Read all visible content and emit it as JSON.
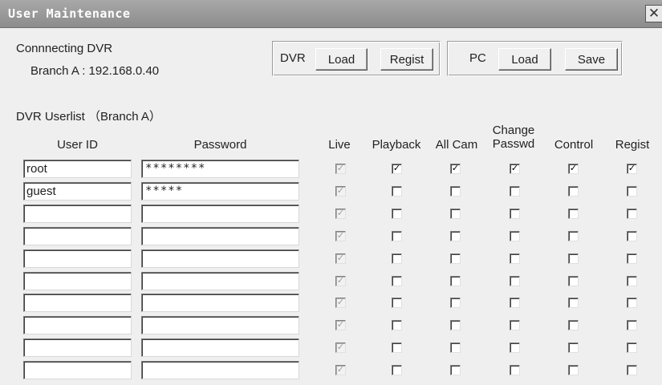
{
  "window": {
    "title": "User Maintenance",
    "close_glyph": "✕"
  },
  "connection": {
    "label": "Connnecting DVR",
    "value": "Branch A : 192.168.0.40"
  },
  "dvr_group": {
    "label": "DVR",
    "load": "Load",
    "regist": "Regist"
  },
  "pc_group": {
    "label": "PC",
    "load": "Load",
    "save": "Save"
  },
  "userlist": {
    "title": "DVR Userlist （Branch A）",
    "columns": {
      "user_id": "User ID",
      "password": "Password",
      "live": "Live",
      "playback": "Playback",
      "all_cam": "All Cam",
      "change_passwd_1": "Change",
      "change_passwd_2": "Passwd",
      "control": "Control",
      "regist": "Regist"
    },
    "rows": [
      {
        "user_id": "root",
        "password": "********",
        "live": true,
        "playback": true,
        "all_cam": true,
        "change_passwd": true,
        "control": true,
        "regist": true
      },
      {
        "user_id": "guest",
        "password": "*****",
        "live": true,
        "playback": false,
        "all_cam": false,
        "change_passwd": false,
        "control": false,
        "regist": false
      },
      {
        "user_id": "",
        "password": "",
        "live": true,
        "playback": false,
        "all_cam": false,
        "change_passwd": false,
        "control": false,
        "regist": false
      },
      {
        "user_id": "",
        "password": "",
        "live": true,
        "playback": false,
        "all_cam": false,
        "change_passwd": false,
        "control": false,
        "regist": false
      },
      {
        "user_id": "",
        "password": "",
        "live": true,
        "playback": false,
        "all_cam": false,
        "change_passwd": false,
        "control": false,
        "regist": false
      },
      {
        "user_id": "",
        "password": "",
        "live": true,
        "playback": false,
        "all_cam": false,
        "change_passwd": false,
        "control": false,
        "regist": false
      },
      {
        "user_id": "",
        "password": "",
        "live": true,
        "playback": false,
        "all_cam": false,
        "change_passwd": false,
        "control": false,
        "regist": false
      },
      {
        "user_id": "",
        "password": "",
        "live": true,
        "playback": false,
        "all_cam": false,
        "change_passwd": false,
        "control": false,
        "regist": false
      },
      {
        "user_id": "",
        "password": "",
        "live": true,
        "playback": false,
        "all_cam": false,
        "change_passwd": false,
        "control": false,
        "regist": false
      },
      {
        "user_id": "",
        "password": "",
        "live": true,
        "playback": false,
        "all_cam": false,
        "change_passwd": false,
        "control": false,
        "regist": false
      }
    ]
  },
  "icons": {
    "close": "close-icon",
    "checkbox": "checkbox-icon"
  }
}
